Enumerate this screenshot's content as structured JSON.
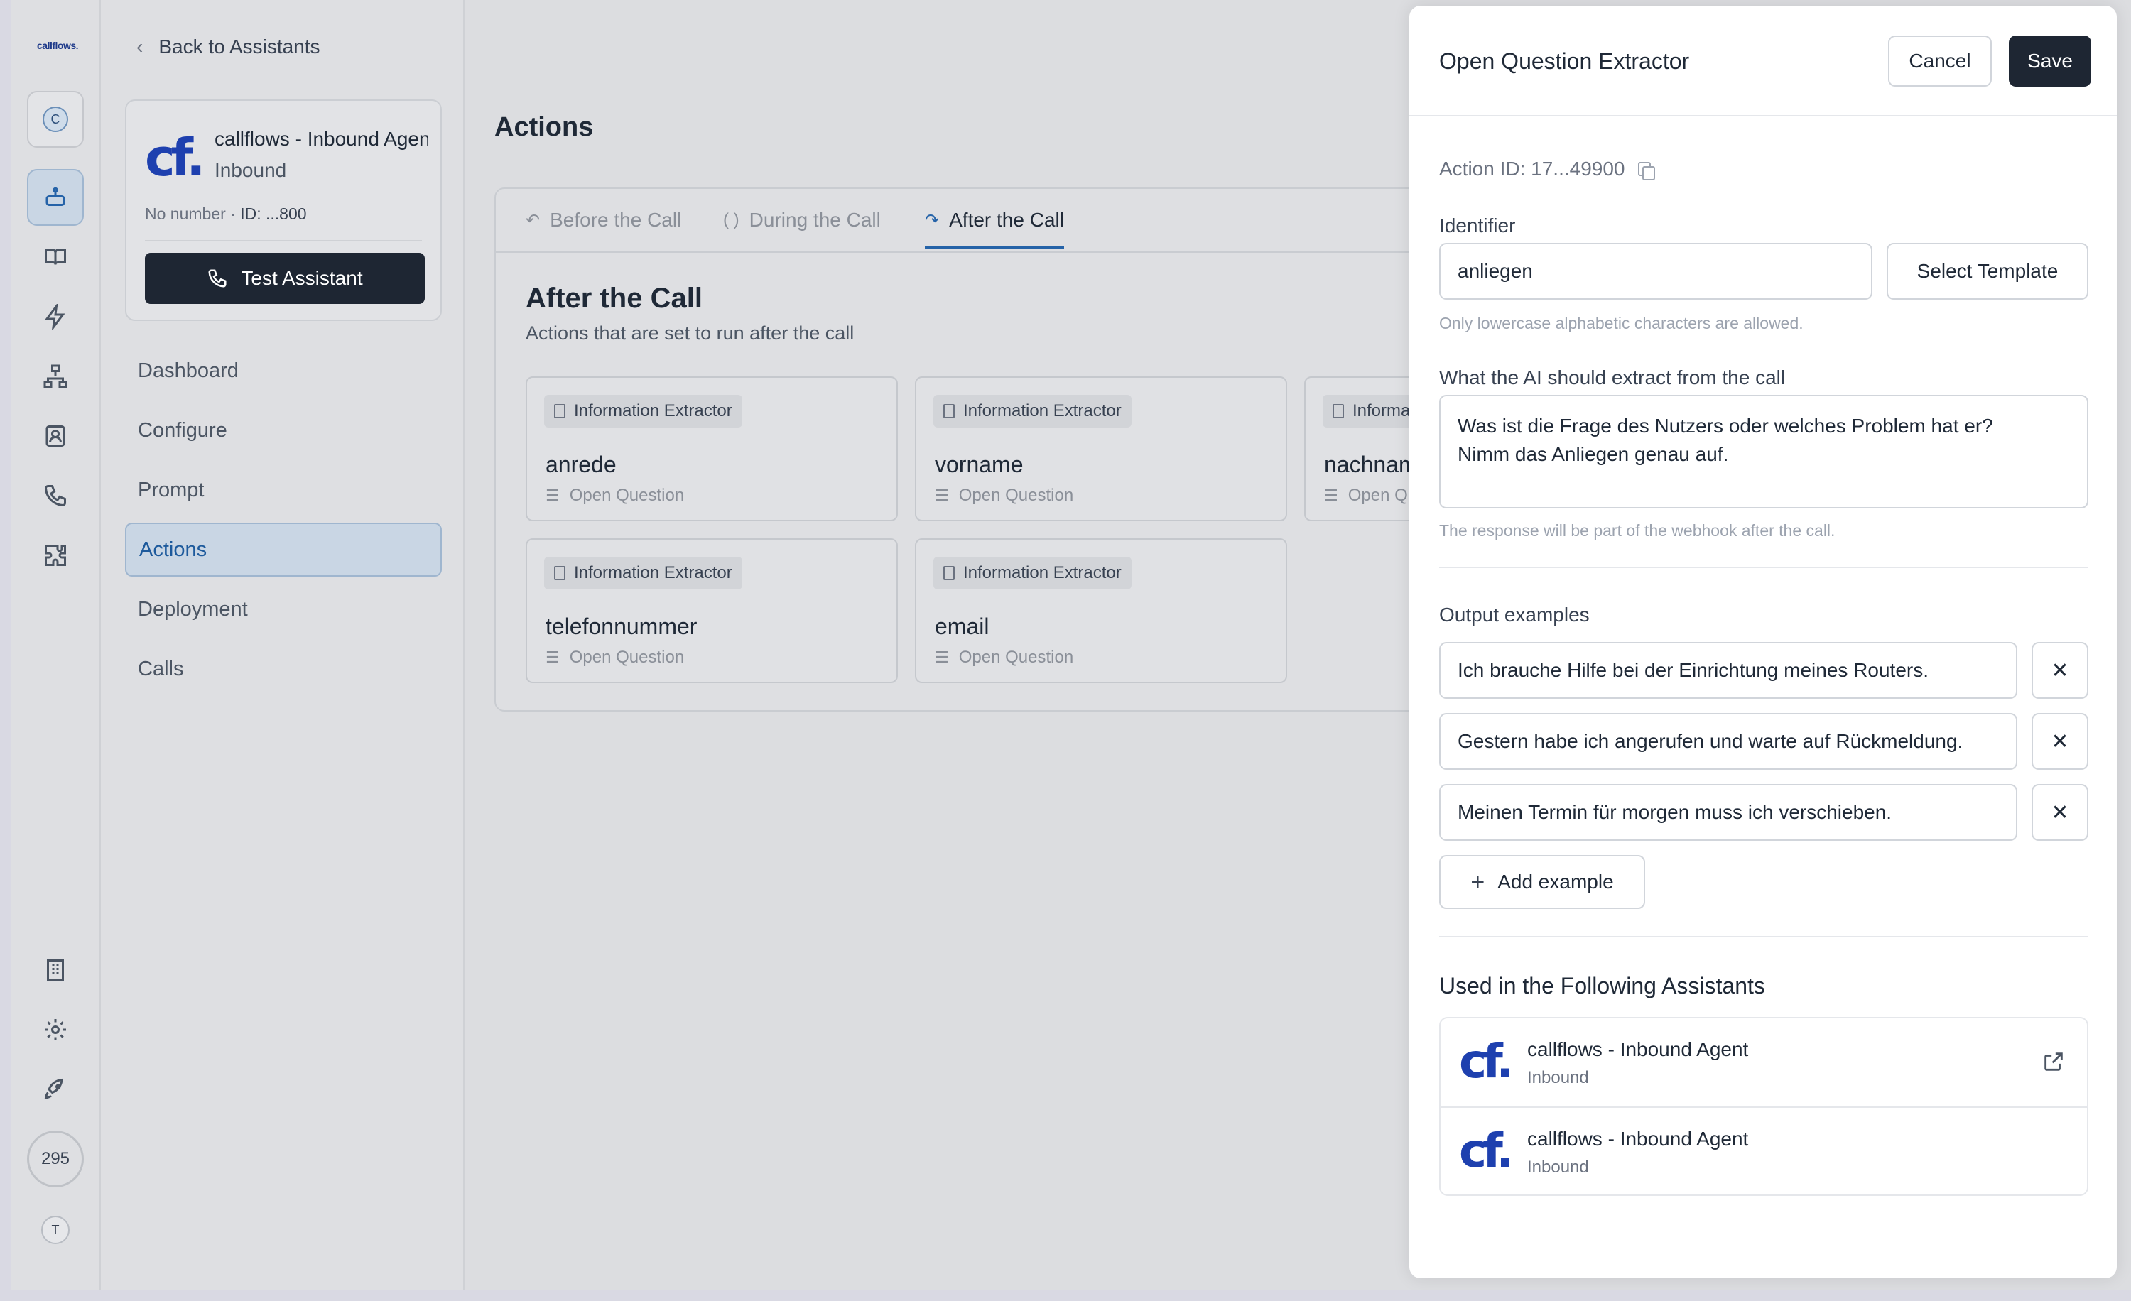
{
  "rail": {
    "logo": "callflows.",
    "workspace_initial": "C",
    "credits": "295",
    "user_initial": "T",
    "icons": [
      "assistant-icon",
      "book-icon",
      "lightning-icon",
      "network-icon",
      "contact-icon",
      "phone-icon",
      "puzzle-icon",
      "building-icon",
      "gear-icon",
      "rocket-icon"
    ]
  },
  "sidebar": {
    "back_label": "Back to Assistants",
    "assistant": {
      "logo_text": "cf.",
      "name": "callflows - Inbound Agent",
      "type": "Inbound",
      "number": "No number",
      "id": "ID: ...800"
    },
    "test_button": "Test Assistant",
    "nav": [
      {
        "label": "Dashboard"
      },
      {
        "label": "Configure"
      },
      {
        "label": "Prompt"
      },
      {
        "label": "Actions"
      },
      {
        "label": "Deployment"
      },
      {
        "label": "Calls"
      }
    ],
    "active_nav": "Actions"
  },
  "main": {
    "title": "Actions",
    "tabs": [
      {
        "label": "Before the Call",
        "glyph": "↶"
      },
      {
        "label": "During the Call",
        "glyph": "( )"
      },
      {
        "label": "After the Call",
        "glyph": "↷"
      }
    ],
    "active_tab": "After the Call",
    "section_title": "After the Call",
    "section_subtitle": "Actions that are set to run after the call",
    "cards": [
      {
        "badge": "Information Extractor",
        "name": "anrede",
        "type": "Open Question"
      },
      {
        "badge": "Information Extractor",
        "name": "vorname",
        "type": "Open Question"
      },
      {
        "badge": "Information Extractor",
        "name": "nachname",
        "type": "Open Question"
      },
      {
        "badge": "Information Extractor",
        "name": "telefonnummer",
        "type": "Open Question"
      },
      {
        "badge": "Information Extractor",
        "name": "email",
        "type": "Open Question"
      }
    ]
  },
  "drawer": {
    "title": "Open Question Extractor",
    "cancel": "Cancel",
    "save": "Save",
    "action_id": "Action ID: 17...49900",
    "identifier_label": "Identifier",
    "identifier_value": "anliegen",
    "select_template": "Select Template",
    "identifier_hint": "Only lowercase alphabetic characters are allowed.",
    "extract_label": "What the AI should extract from the call",
    "extract_value": "Was ist die Frage des Nutzers oder welches Problem hat er?\nNimm das Anliegen genau auf.",
    "extract_hint": "The response will be part of the webhook after the call.",
    "examples_label": "Output examples",
    "examples": [
      "Ich brauche Hilfe bei der Einrichtung meines Routers.",
      "Gestern habe ich angerufen und warte auf Rückmeldung.",
      "Meinen Termin für morgen muss ich verschieben."
    ],
    "add_example": "Add example",
    "used_title": "Used in the Following Assistants",
    "used": [
      {
        "logo_text": "cf.",
        "name": "callflows - Inbound Agent",
        "type": "Inbound"
      },
      {
        "logo_text": "cf.",
        "name": "callflows - Inbound Agent",
        "type": "Inbound"
      }
    ]
  }
}
